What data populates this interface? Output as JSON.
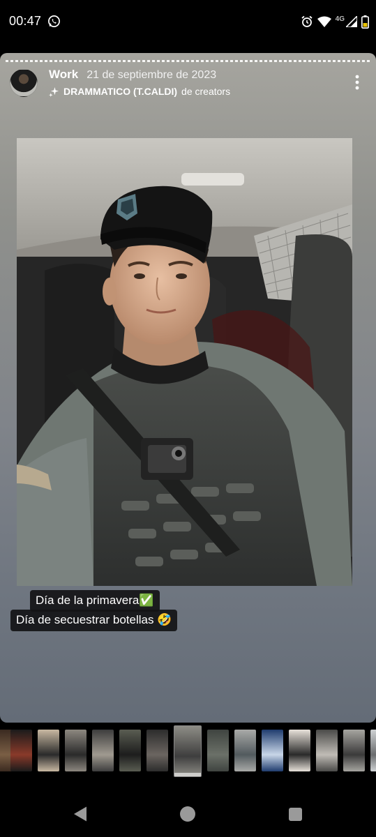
{
  "status_bar": {
    "time": "00:47",
    "network": "4G",
    "icons": [
      "whatsapp-icon",
      "alarm-icon",
      "wifi-icon",
      "signal-icon",
      "battery-icon"
    ]
  },
  "story": {
    "username": "Work",
    "date": "21 de septiembre de 2023",
    "music": {
      "title": "DRAMMATICO (T.CALDI)",
      "artist_suffix": "de creators"
    },
    "captions": [
      "Día de la primavera✅",
      "Día de secuestrar botellas 🤣"
    ],
    "background_colors": [
      "#a6a59f",
      "#646c77"
    ]
  },
  "thumbnails": {
    "count": 14,
    "active_index": 6
  },
  "nav": {
    "icons": [
      "back-icon",
      "home-icon",
      "recents-icon"
    ]
  }
}
